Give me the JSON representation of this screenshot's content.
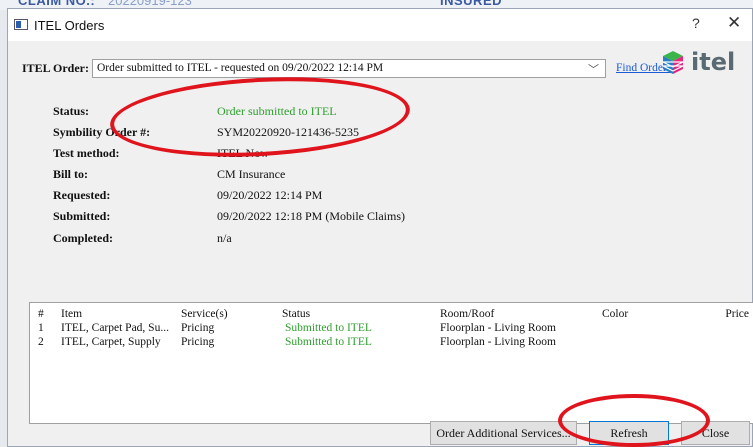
{
  "background": {
    "claim_label": "CLAIM NO.:",
    "claim_value": "20220919-123",
    "insured_label": "INSURED"
  },
  "window": {
    "title": "ITEL Orders",
    "help_glyph": "?",
    "close_glyph": "✕"
  },
  "order": {
    "label": "ITEL Order:",
    "selected": "Order submitted to ITEL - requested on 09/20/2022 12:14 PM",
    "find_link": "Find Orders",
    "logo_text": "itel"
  },
  "details": [
    {
      "label": "Status:",
      "value": "Order submitted to ITEL",
      "status": "green"
    },
    {
      "label": "Symbility Order #:",
      "value": "SYM20220920-121436-5235"
    },
    {
      "label": "Test method:",
      "value": "ITEL Now"
    },
    {
      "label": "Bill to:",
      "value": "CM Insurance"
    },
    {
      "label": "Requested:",
      "value": "09/20/2022 12:14 PM"
    },
    {
      "label": "Submitted:",
      "value": "09/20/2022 12:18 PM (Mobile Claims)"
    },
    {
      "label": "Completed:",
      "value": "n/a"
    }
  ],
  "grid": {
    "headers": {
      "num": "#",
      "item": "Item",
      "service": "Service(s)",
      "status": "Status",
      "room": "Room/Roof",
      "color": "Color",
      "price": "Price"
    },
    "rows": [
      {
        "num": "1",
        "item": "ITEL, Carpet Pad, Su...",
        "service": "Pricing",
        "status": "Submitted to ITEL",
        "room": "Floorplan - Living Room",
        "color": "",
        "price": ""
      },
      {
        "num": "2",
        "item": "ITEL, Carpet, Supply",
        "service": "Pricing",
        "status": "Submitted to ITEL",
        "room": "Floorplan - Living Room",
        "color": "",
        "price": ""
      }
    ]
  },
  "buttons": {
    "order_additional": "Order Additional Services...",
    "refresh": "Refresh",
    "close": "Close"
  },
  "colors": {
    "status_green": "#2f9e2f",
    "link_blue": "#1a5bd6",
    "annotation_red": "#e0141c",
    "logo_gray": "#5a6a73"
  },
  "icons": [
    "window-app-icon",
    "help-icon",
    "close-icon",
    "chevron-down-icon",
    "itel-logo-icon"
  ]
}
